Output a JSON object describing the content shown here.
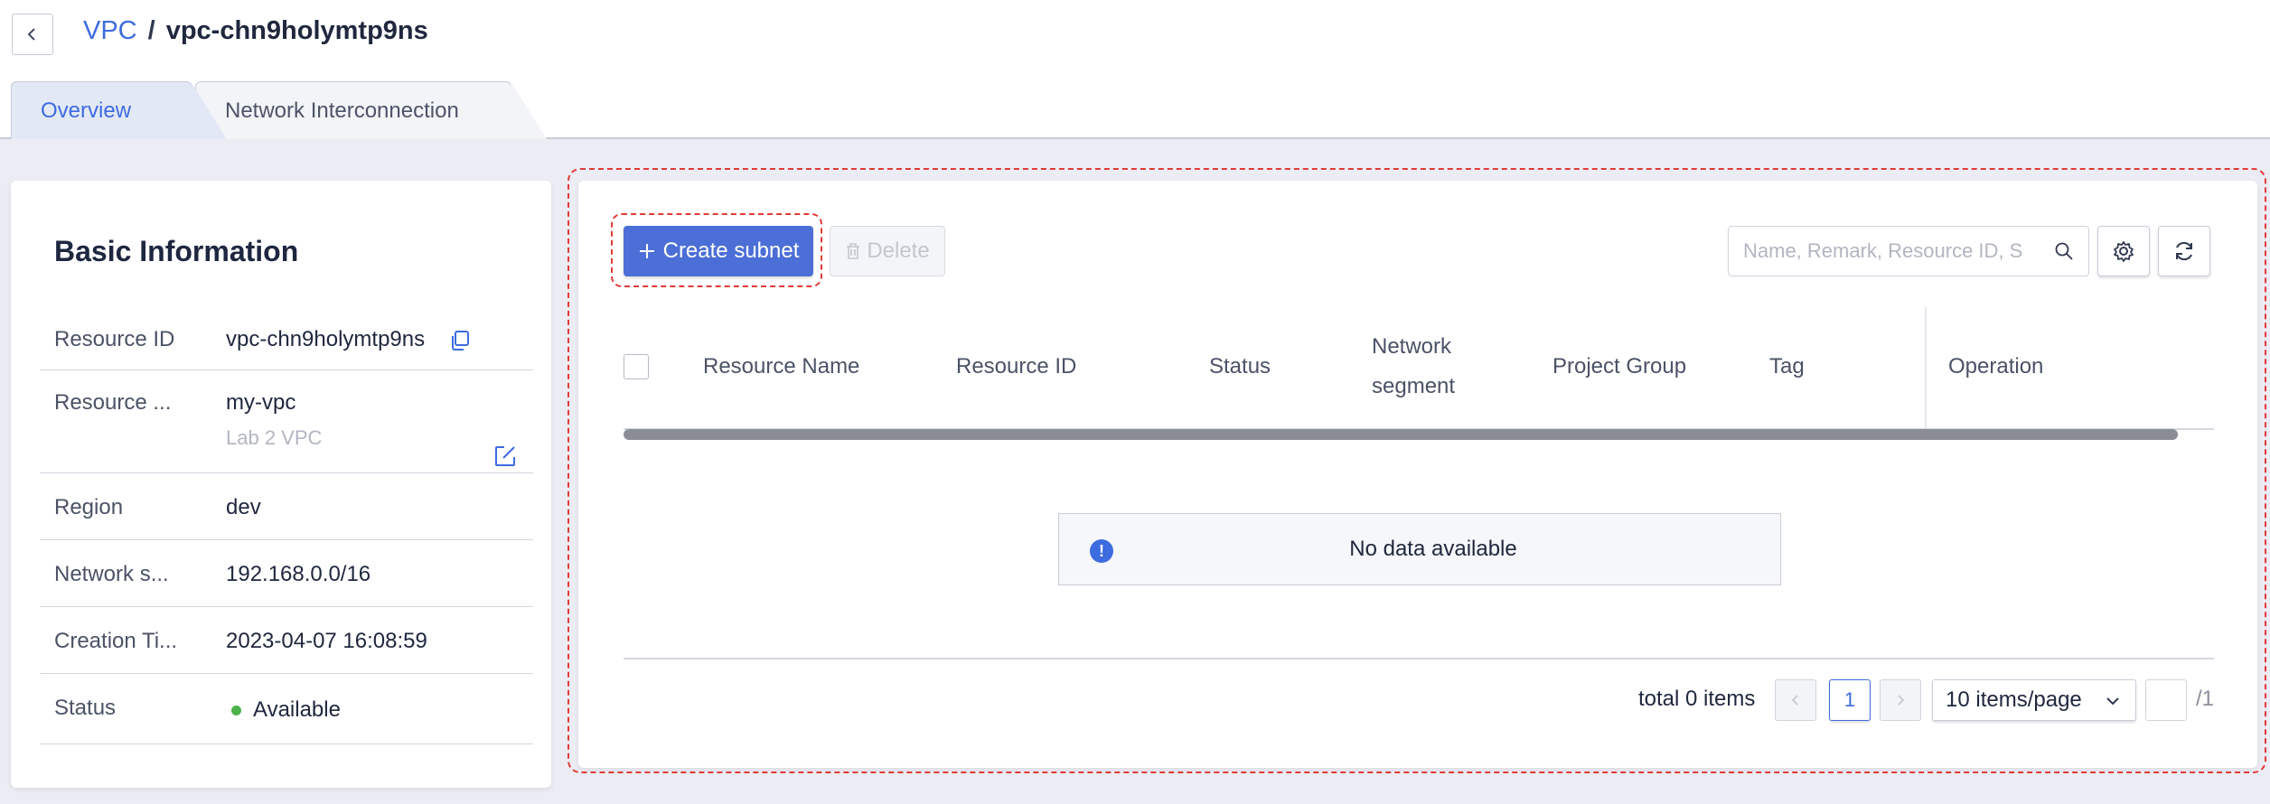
{
  "header": {
    "breadcrumb": {
      "parent": "VPC",
      "separator": "/",
      "current": "vpc-chn9holymtp9ns"
    }
  },
  "tabs": [
    {
      "label": "Overview",
      "active": true
    },
    {
      "label": "Network Interconnection",
      "active": false
    }
  ],
  "basic_info": {
    "title": "Basic Information",
    "rows": [
      {
        "label": "Resource ID",
        "value": "vpc-chn9holymtp9ns"
      },
      {
        "label": "Resource ...",
        "value": "my-vpc",
        "sub": "Lab 2 VPC"
      },
      {
        "label": "Region",
        "value": "dev"
      },
      {
        "label": "Network s...",
        "value": "192.168.0.0/16"
      },
      {
        "label": "Creation Ti...",
        "value": "2023-04-07 16:08:59"
      },
      {
        "label": "Status",
        "value": "Available",
        "status_color": "#4db24c"
      }
    ]
  },
  "toolbar": {
    "create_label": "Create subnet",
    "delete_label": "Delete",
    "search_placeholder": "Name, Remark, Resource ID, S"
  },
  "table": {
    "columns": [
      "Resource Name",
      "Resource ID",
      "Status",
      "Network",
      "segment",
      "Project Group",
      "Tag",
      "Operation"
    ],
    "empty_text": "No data available",
    "rows": []
  },
  "pagination": {
    "total_text": "total 0 items",
    "current_page": "1",
    "page_size": "10 items/page",
    "total_pages": "/1"
  },
  "colors": {
    "accent": "#3d6be0",
    "primary_button": "#4b6fd6",
    "highlight_dash": "#e03b35"
  }
}
